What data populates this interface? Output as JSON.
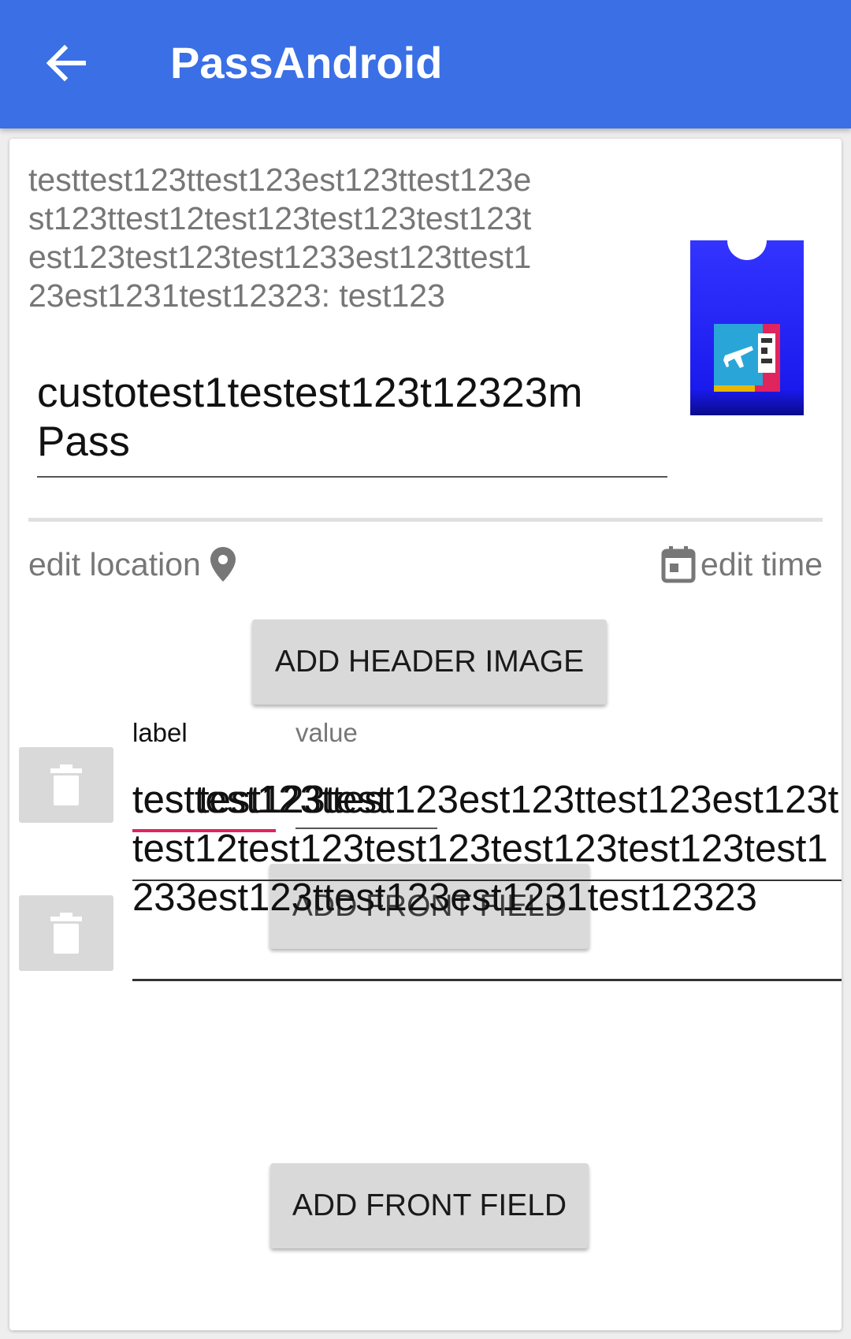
{
  "app_bar": {
    "title": "PassAndroid",
    "back_icon": "arrow-left-icon",
    "color": "#3a6fe6"
  },
  "pass": {
    "description": "testtest123ttest123est123ttest123est123ttest12test123test123test123test123test123test1233est123ttest123est1231test12323: test123",
    "name": "custotest1testest123t12323m Pass",
    "icon": "boarding-pass-icon"
  },
  "actions": {
    "edit_location": "edit location",
    "edit_time": "edit time",
    "add_header_image": "ADD HEADER IMAGE",
    "add_front_field": "ADD FRONT FIELD"
  },
  "field_editor": {
    "label_caption": "label",
    "value_caption": "value",
    "label_value": "testtest",
    "ghost_value": "test123test",
    "value_text": "testtest123ttest123est123ttest123est123ttest12test123test123test123test123test1233est123ttest123est1231test12323"
  }
}
